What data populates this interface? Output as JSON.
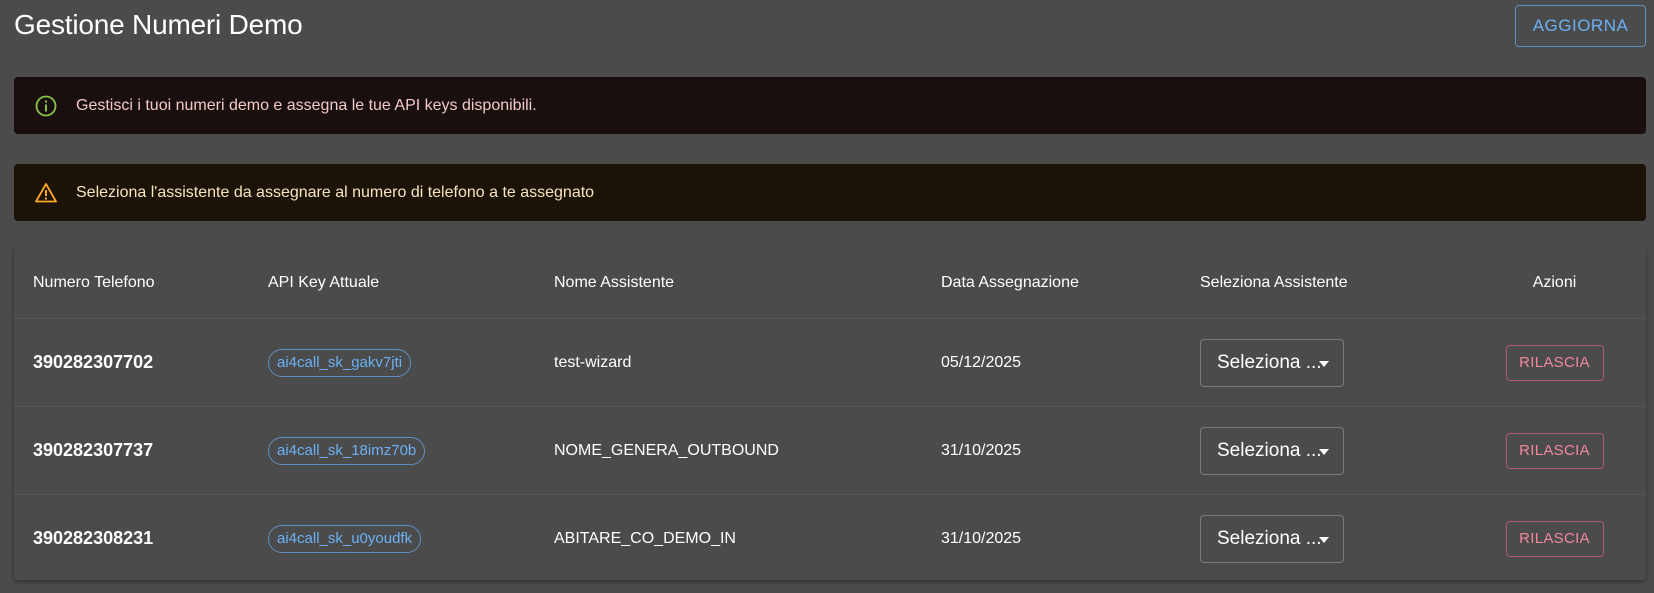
{
  "header": {
    "title": "Gestione Numeri Demo",
    "refresh_label": "AGGIORNA"
  },
  "alerts": {
    "info": {
      "icon": "info-icon",
      "color": "#8bc34a",
      "text": "Gestisci i tuoi numeri demo e assegna le tue API keys disponibili."
    },
    "warning": {
      "icon": "warning-icon",
      "color": "#ffa726",
      "text": "Seleziona l'assistente da assegnare al numero di telefono a te assegnato"
    }
  },
  "table": {
    "columns": [
      "Numero Telefono",
      "API Key Attuale",
      "Nome Assistente",
      "Data Assegnazione",
      "Seleziona Assistente",
      "Azioni"
    ],
    "rows": [
      {
        "phone": "390282307702",
        "api_key": "ai4call_sk_gakv7jti",
        "assistant": "test-wizard",
        "date": "05/12/2025",
        "select_value": "Seleziona ...",
        "action": "RILASCIA"
      },
      {
        "phone": "390282307737",
        "api_key": "ai4call_sk_18imz70b",
        "assistant": "NOME_GENERA_OUTBOUND",
        "date": "31/10/2025",
        "select_value": "Seleziona ...",
        "action": "RILASCIA"
      },
      {
        "phone": "390282308231",
        "api_key": "ai4call_sk_u0youdfk",
        "assistant": "ABITARE_CO_DEMO_IN",
        "date": "31/10/2025",
        "select_value": "Seleziona ...",
        "action": "RILASCIA"
      }
    ]
  },
  "colors": {
    "background": "#4b4b4b",
    "primary": "#6ab0f5",
    "error": "#f2879b",
    "info_bg": "#190f0e",
    "warning_bg": "#1b1406"
  }
}
